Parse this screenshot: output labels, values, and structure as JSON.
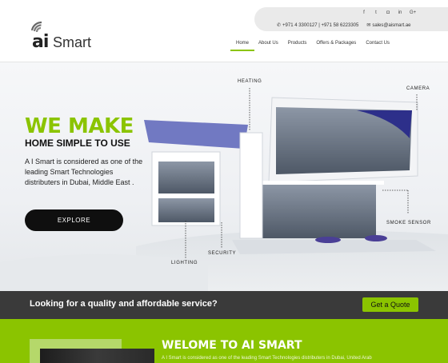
{
  "brand": {
    "logo_ai": "ai",
    "logo_smart": "Smart"
  },
  "topbar": {
    "social_icons": [
      "facebook-icon",
      "twitter-icon",
      "instagram-icon",
      "linkedin-icon",
      "google-plus-icon"
    ],
    "social_glyphs": [
      "f",
      "t",
      "◘",
      "in",
      "G+"
    ],
    "phone": "+971 4 3300127 | +971 58 6223305",
    "email": "sales@aismart.ae"
  },
  "nav": {
    "items": [
      {
        "label": "Home",
        "active": true
      },
      {
        "label": "About Us"
      },
      {
        "label": "Products"
      },
      {
        "label": "Offers & Packages"
      },
      {
        "label": "Contact Us"
      }
    ]
  },
  "hero": {
    "title": "WE MAKE",
    "subtitle": "HOME SIMPLE TO USE",
    "description": "A I Smart is considered as one of the leading Smart Technologies distributers in Dubai, Middle East .",
    "button": "EXPLORE",
    "labels": {
      "heating": "HEATING",
      "camera": "CAMERA",
      "smoke": "SMOKE SENSOR",
      "security": "SECURITY",
      "lighting": "LIGHTING"
    }
  },
  "cta": {
    "text": "Looking for a quality and affordable service?",
    "button": "Get a Quote"
  },
  "welcome": {
    "title": "WELOME TO AI SMART",
    "text": "A I Smart is considered as one of the leading Smart Technologies distributers in Dubai, United Arab"
  },
  "colors": {
    "accent": "#8bc400",
    "dark": "#3a3a3a",
    "black": "#0f0f0f"
  }
}
